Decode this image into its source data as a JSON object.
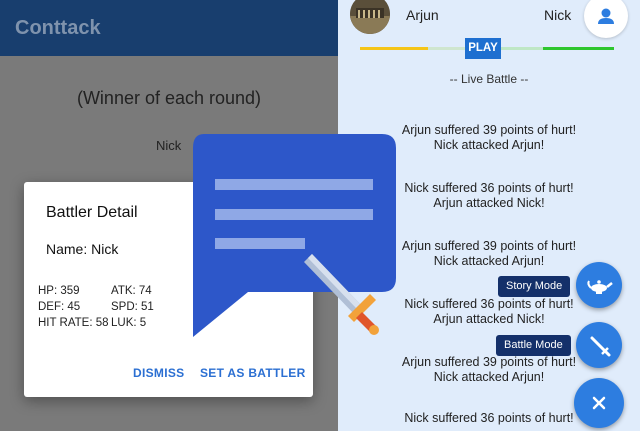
{
  "app": {
    "title": "Conttack"
  },
  "background": {
    "winner_heading": "(Winner of each round)",
    "winner_name": "Nick"
  },
  "dialog": {
    "title": "Battler Detail",
    "name_line": "Name: Nick",
    "stats": {
      "hp": "HP: 359",
      "atk": "ATK: 74",
      "def": "DEF: 45",
      "spd": "SPD: 51",
      "hit_rate": "HIT RATE: 58",
      "luk": "LUK: 5"
    },
    "dismiss_label": "DISMISS",
    "set_label": "SET AS BATTLER"
  },
  "battle": {
    "player_left": "Arjun",
    "player_right": "Nick",
    "play_label": "PLAY",
    "live_label": "-- Live Battle --",
    "log": [
      {
        "line1": "Arjun suffered 39 points of hurt!",
        "line2": "Nick attacked Arjun!"
      },
      {
        "line1": "Nick suffered 36 points of hurt!",
        "line2": "Arjun attacked Nick!"
      },
      {
        "line1": "Arjun suffered 39 points of hurt!",
        "line2": "Nick attacked Arjun!"
      },
      {
        "line1": "Nick suffered 36 points of hurt!",
        "line2": "Arjun attacked Nick!"
      },
      {
        "line1": "Arjun suffered 39 points of hurt!",
        "line2": "Nick attacked Arjun!"
      },
      {
        "line1": "Nick suffered 36 points of hurt!",
        "line2": ""
      }
    ]
  },
  "fab_menu": {
    "story_label": "Story Mode",
    "battle_label": "Battle Mode"
  },
  "icons": {
    "profile": "person-icon",
    "story": "magic-lamp-icon",
    "battle": "sword-icon",
    "close": "close-icon",
    "feature": "chat-bubble-sword-icon"
  },
  "colors": {
    "appbar": "#183e6e",
    "accent_blue": "#2d7de0",
    "log_background": "#e0ecfb",
    "health_left": "#f5c518",
    "health_right": "#2ec62e"
  }
}
